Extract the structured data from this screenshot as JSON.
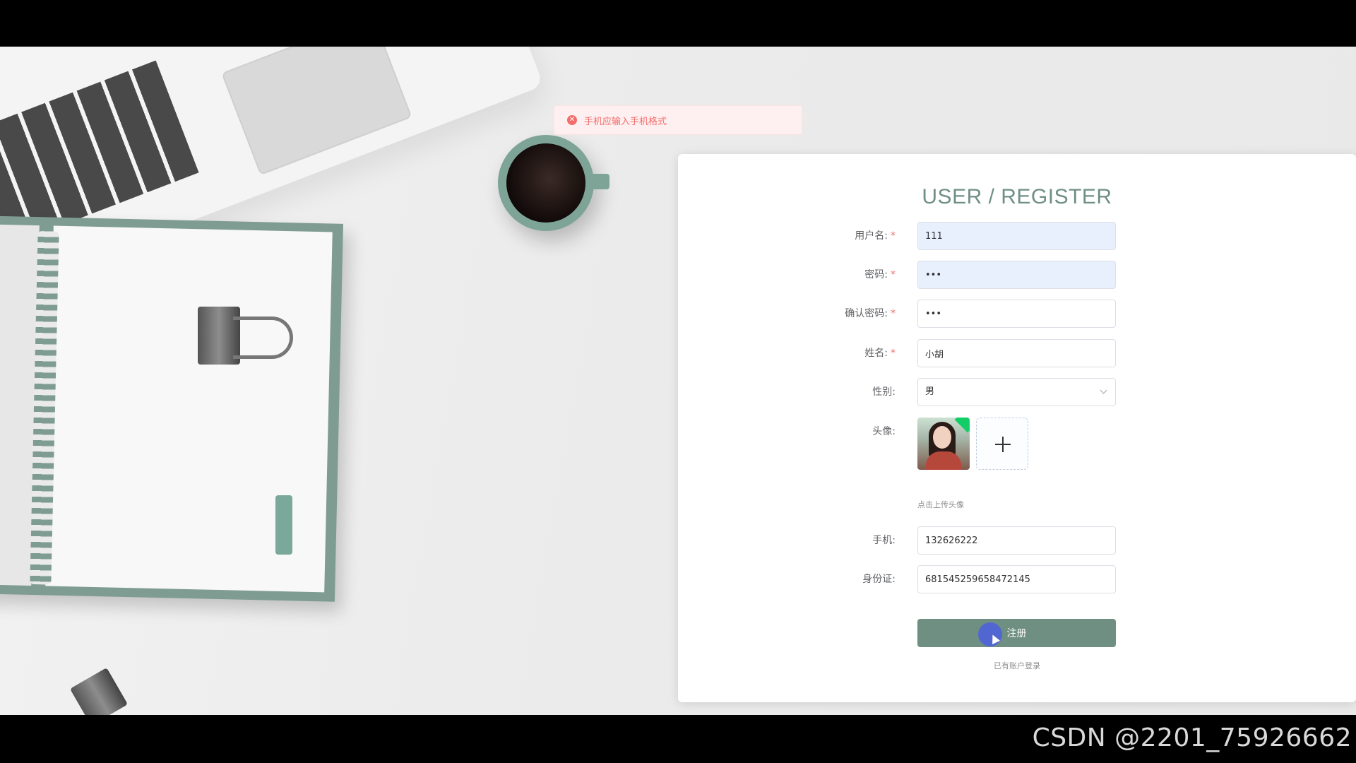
{
  "toast": {
    "icon": "error-circle-icon",
    "message": "手机应输入手机格式",
    "color": "#f56c6c"
  },
  "form": {
    "title": "USER / REGISTER",
    "username": {
      "label": "用户名:",
      "value": "111",
      "required": "*"
    },
    "password": {
      "label": "密码:",
      "value": "•••",
      "required": "*"
    },
    "confirm": {
      "label": "确认密码:",
      "value": "•••",
      "required": "*"
    },
    "name": {
      "label": "姓名:",
      "value": "小胡",
      "required": "*"
    },
    "gender": {
      "label": "性别:",
      "value": "男"
    },
    "avatar": {
      "label": "头像:",
      "tip": "点击上传头像"
    },
    "phone": {
      "label": "手机:",
      "value": "132626222"
    },
    "idcard": {
      "label": "身份证:",
      "value": "681545259658472145"
    },
    "submit": {
      "label": "注册",
      "color": "#6f8f83"
    },
    "login_link": "已有账户登录"
  },
  "watermark": "CSDN @2201_75926662",
  "colors": {
    "accent": "#6f8f87",
    "required": "#f56c6c"
  }
}
